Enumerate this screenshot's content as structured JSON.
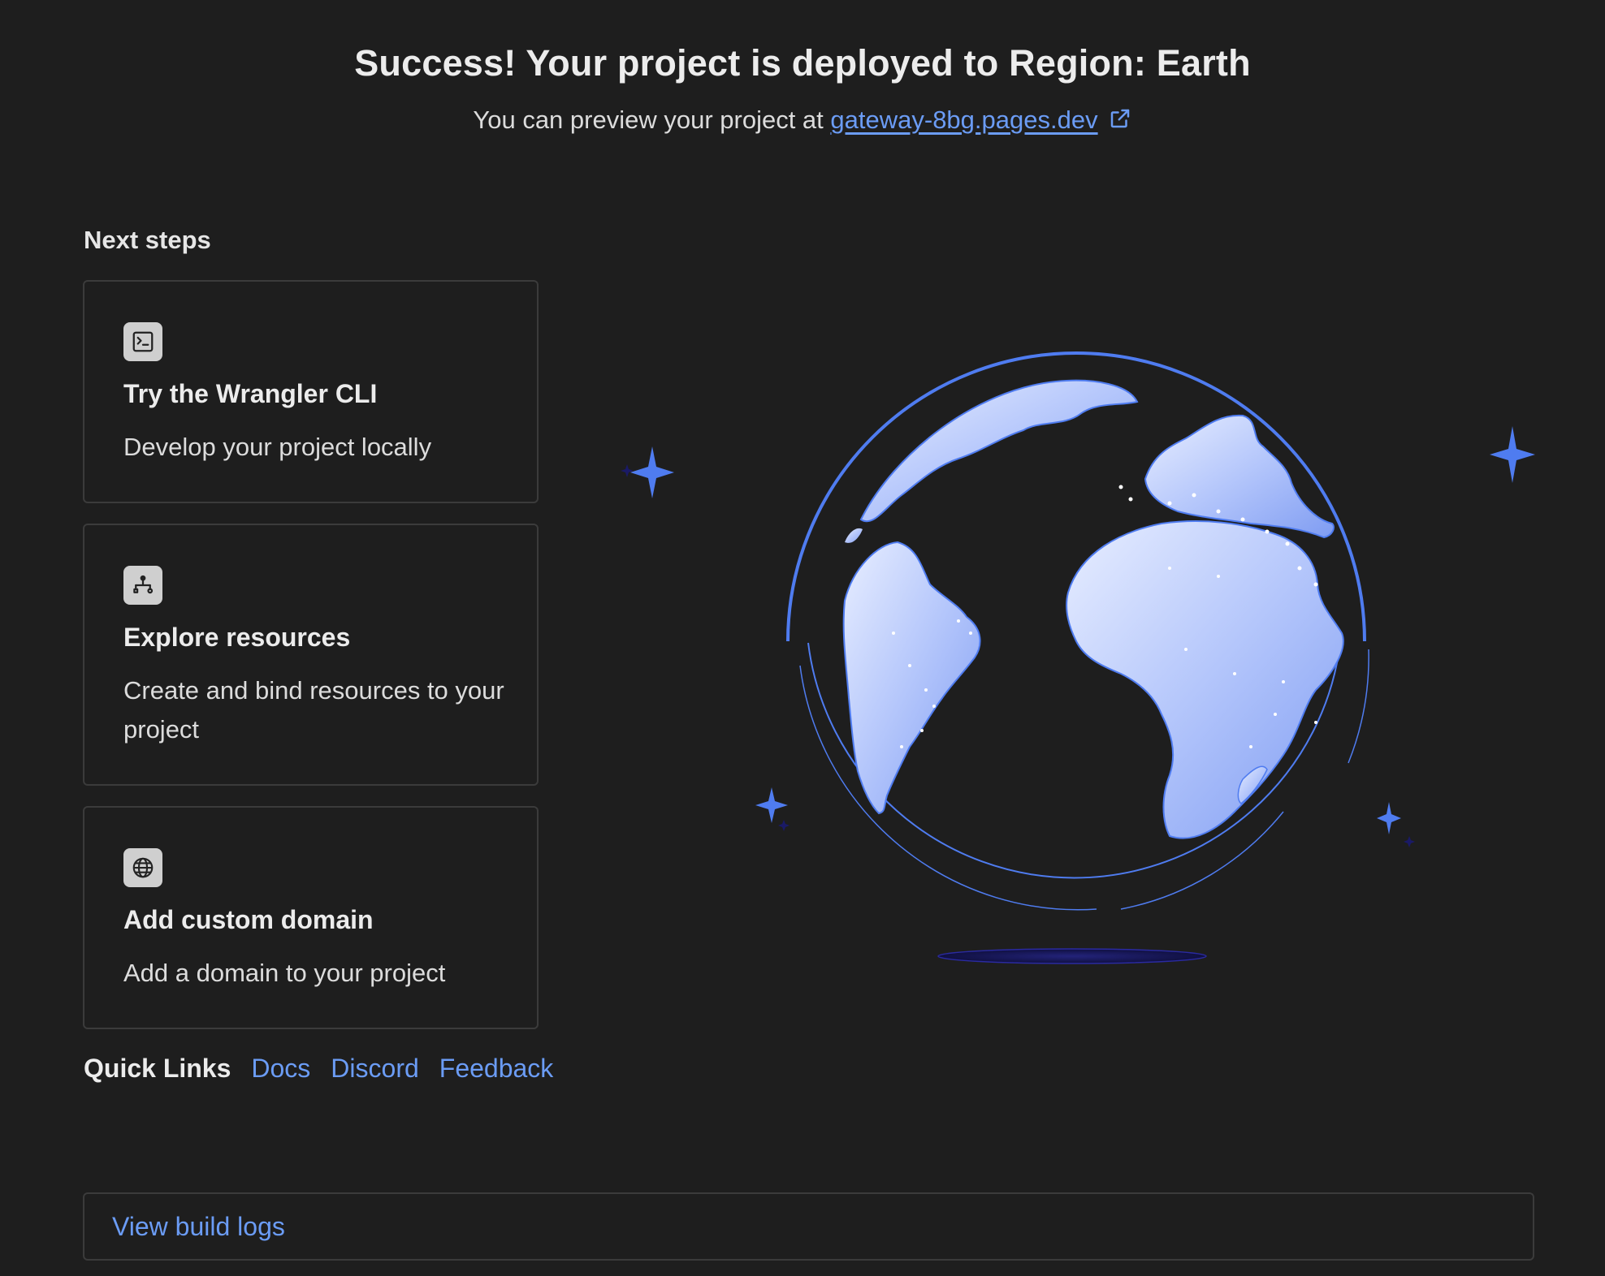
{
  "header": {
    "title": "Success! Your project is deployed to Region: Earth",
    "preview_prefix": "You can preview your project at",
    "preview_link": "gateway-8bg.pages.dev",
    "external_icon": "external-link-icon"
  },
  "next_steps": {
    "title": "Next steps",
    "cards": [
      {
        "icon": "terminal-icon",
        "title": "Try the Wrangler CLI",
        "description": "Develop your project locally"
      },
      {
        "icon": "resources-icon",
        "title": "Explore resources",
        "description": "Create and bind resources to your project"
      },
      {
        "icon": "globe-icon",
        "title": "Add custom domain",
        "description": "Add a domain to your project"
      }
    ]
  },
  "quick_links": {
    "label": "Quick Links",
    "docs": "Docs",
    "discord": "Discord",
    "feedback": "Feedback"
  },
  "build_logs": {
    "label": "View build logs"
  },
  "illustration": {
    "icon": "earth-globe-illustration",
    "accent_color": "#4f7cf0"
  },
  "colors": {
    "background": "#1e1e1e",
    "link": "#6b9cf5",
    "border": "#3b3b3b"
  }
}
